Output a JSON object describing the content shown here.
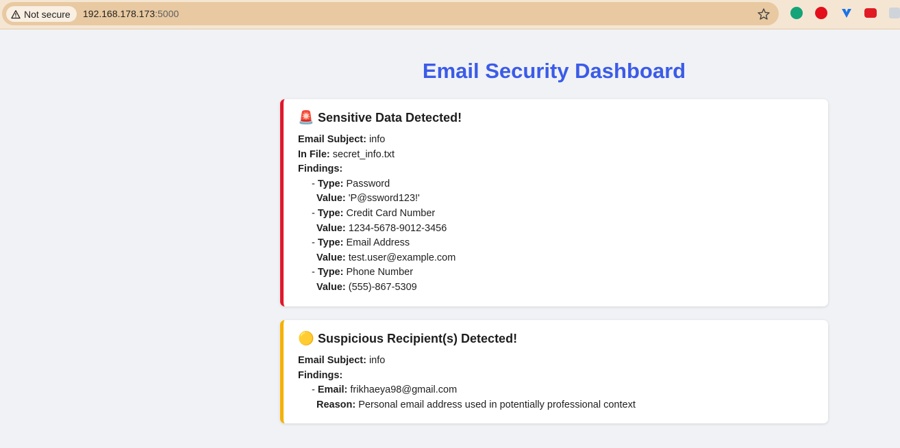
{
  "browser": {
    "security_label": "Not secure",
    "url_host": "192.168.178.173",
    "url_port": ":5000"
  },
  "page": {
    "title": "Email Security Dashboard"
  },
  "sensitive_card": {
    "icon": "🚨",
    "heading": "Sensitive Data Detected!",
    "subject_label": "Email Subject:",
    "subject": "info",
    "file_label": "In File:",
    "file": "secret_info.txt",
    "findings_label": "Findings:",
    "type_label": "Type:",
    "value_label": "Value:",
    "findings": [
      {
        "type": "Password",
        "value": "'P@ssword123!'"
      },
      {
        "type": "Credit Card Number",
        "value": "1234-5678-9012-3456"
      },
      {
        "type": "Email Address",
        "value": "test.user@example.com"
      },
      {
        "type": "Phone Number",
        "value": "(555)-867-5309"
      }
    ]
  },
  "recipient_card": {
    "icon": "🟡",
    "heading": "Suspicious Recipient(s) Detected!",
    "subject_label": "Email Subject:",
    "subject": "info",
    "findings_label": "Findings:",
    "email_label": "Email:",
    "email": "frikhaeya98@gmail.com",
    "reason_label": "Reason:",
    "reason": "Personal email address used in potentially professional context"
  },
  "colors": {
    "title": "#3b5be8",
    "sensitive_accent": "#e0182a",
    "recipient_accent": "#f5b100"
  }
}
